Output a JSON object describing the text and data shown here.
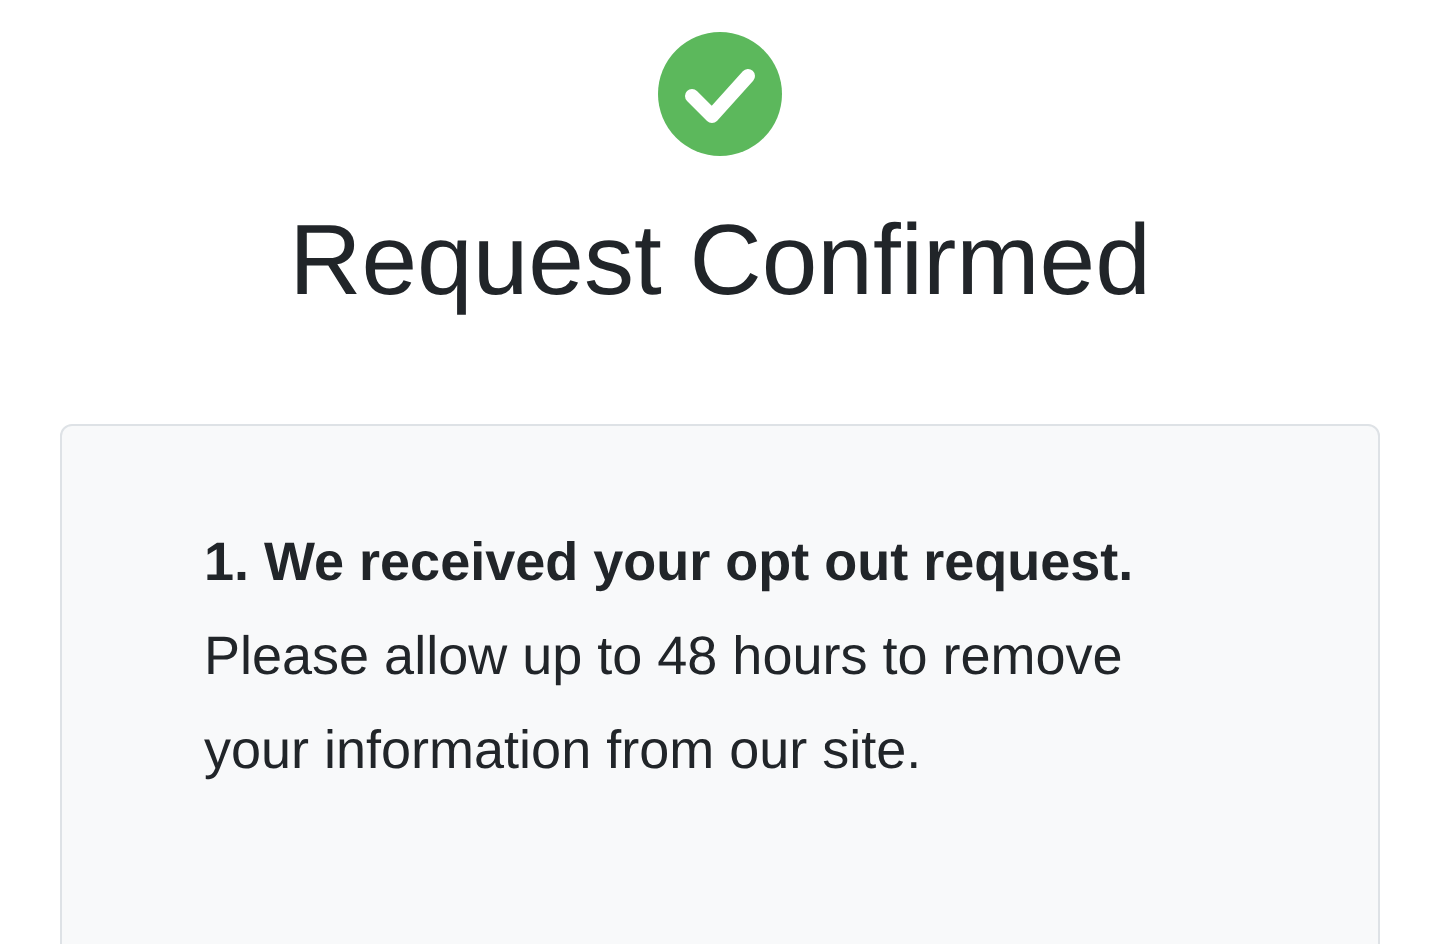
{
  "heading": "Request Confirmed",
  "steps": [
    {
      "text": "**1. We received your opt out request.** Please allow up to 48 hours to remove your information from our site."
    }
  ]
}
